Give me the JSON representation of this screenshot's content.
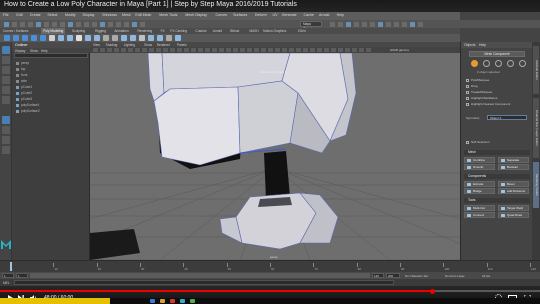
{
  "video": {
    "title": "How to Create a Low Poly Character in Maya [Part 1] | Step by Step Maya 2016/2019 Tutorials",
    "time_display": "48:00 / 60:00",
    "progress": 0.8
  },
  "maya": {
    "menubar": [
      "File",
      "Edit",
      "Create",
      "Select",
      "Modify",
      "Display",
      "Windows",
      "Mesh",
      "Edit Mesh",
      "Mesh Tools",
      "Mesh Display",
      "Curves",
      "Surfaces",
      "Deform",
      "UV",
      "Generate",
      "Cache",
      "Arnold",
      "Help"
    ],
    "workspace": "Maya Classic",
    "shelf_tabs": [
      "Curves / Surfaces",
      "Poly Modeling",
      "Sculpting",
      "Rigging",
      "Animation",
      "Rendering",
      "FX",
      "FX Caching",
      "Custom",
      "Arnold",
      "Bifrost",
      "MASH",
      "Motion Graphics",
      "XGen"
    ],
    "shelf_active_index": 1,
    "outliner": {
      "title": "Outliner",
      "menu": [
        "Display",
        "Show",
        "Help"
      ],
      "items": [
        "persp",
        "top",
        "front",
        "side",
        "pCube1",
        "pCube2",
        "pCube3",
        "polySurface1",
        "polySurface2"
      ]
    },
    "viewport": {
      "menu": [
        "View",
        "Shading",
        "Lighting",
        "Show",
        "Renderer",
        "Panels"
      ],
      "object_label": "Symmetry: Object X",
      "camera_label": "persp",
      "color_space": "sRGB gamma"
    },
    "modeling_toolkit": {
      "tabs": [
        "Objects",
        "Help"
      ],
      "button": "Mesh Component",
      "selection_label": "0 object selected",
      "options": [
        "Pick/Marquee",
        "Drag",
        "Tweak/Marquee",
        "Highlight Backfaces",
        "Highlight Nearest Component"
      ],
      "symmetry_label": "Symmetry",
      "symmetry_value": "Object X",
      "soft_selection": "Soft Selection",
      "sections": [
        "Mesh",
        "Components",
        "Tools"
      ],
      "mesh_buttons": [
        "Combine",
        "Separate",
        "Smooth",
        "Boolean"
      ],
      "component_buttons": [
        "Extrude",
        "Bevel",
        "Bridge",
        "Add Divisions"
      ],
      "tool_buttons": [
        "Multi-Cut",
        "Target Weld",
        "Connect",
        "Quad Draw"
      ],
      "vertical_tabs": [
        "Attribute Editor",
        "Channel Box / Layer Editor",
        "Modeling Toolkit"
      ]
    },
    "timeline": {
      "ticks": [
        "1",
        "10",
        "20",
        "30",
        "40",
        "50",
        "60",
        "70",
        "80",
        "90",
        "100",
        "110",
        "120"
      ],
      "start": "1",
      "end": "120",
      "range_end": "200",
      "current": "1",
      "character_set": "No Character Set",
      "anim_layer": "No Anim Layer",
      "fps": "24 fps"
    },
    "mel_label": "MEL"
  },
  "colors": {
    "accent_blue": "#4a7fb3",
    "youtube_red": "#ee0000",
    "taskbar_yellow": "#e6c000"
  }
}
